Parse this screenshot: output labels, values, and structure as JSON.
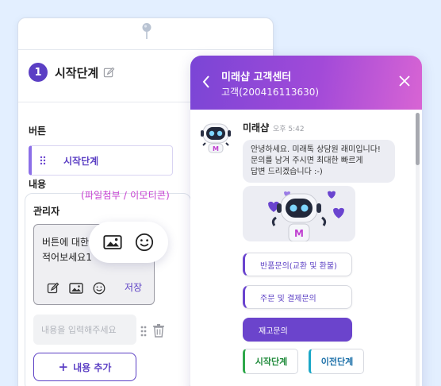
{
  "editor": {
    "step_number": "1",
    "step_name": "시작단계",
    "button_section_label": "버튼",
    "button_item_label": "시작단계",
    "content_section_label": "내용",
    "author_label": "관리자",
    "message_text": "버튼에 대한\n적어보세요1",
    "save_label": "저장",
    "new_content_placeholder": "내용을 입력해주세요",
    "add_content_label": "내용 추가",
    "add_content_icon": "+"
  },
  "attachment_popup": {
    "caption": "(파일첨부 / 이모티콘)",
    "icons": [
      "image-icon",
      "emoji-icon"
    ]
  },
  "chat": {
    "title": "미래샵 고객센터",
    "subtitle": "고객(200416113630)",
    "bot_name": "미래샵",
    "time": "오후 5:42",
    "greeting": "안녕하세요. 미래톡 상담원 래미입니다!\n문의를 남겨 주시면 최대한 빠르게\n답변 드리겠습니다 :-)",
    "options": [
      {
        "label": "반품문의(교환 및 환불)"
      },
      {
        "label": "주문 및 결제문의"
      },
      {
        "label": "재고문의"
      }
    ],
    "nav": {
      "start_label": "시작단계",
      "prev_label": "이전단계"
    }
  },
  "colors": {
    "accent": "#5b3fc4",
    "header_gradient_start": "#7a45d6",
    "header_gradient_end": "#d864d4",
    "background": "#e3efff",
    "caption": "#c63fd1",
    "start_green": "#2ea84a",
    "prev_teal": "#1ba7c7"
  }
}
